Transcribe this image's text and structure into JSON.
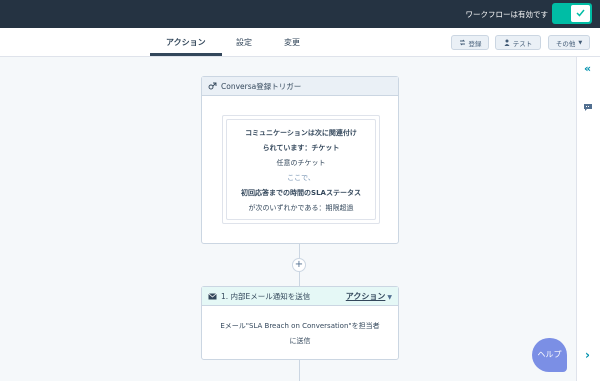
{
  "topbar": {
    "workflow_status": "ワークフローは有効です",
    "toggle_on": true
  },
  "tabs": [
    {
      "label": "アクション",
      "active": true
    },
    {
      "label": "設定",
      "active": false
    },
    {
      "label": "変更",
      "active": false
    }
  ],
  "toolbar": {
    "register_label": "登録",
    "test_label": "テスト",
    "more_label": "その他"
  },
  "trigger": {
    "title": "Conversa登録トリガー",
    "lines": [
      "コミュニケーションは次に関連付け",
      "られています：チケット",
      "任意のチケット",
      "ここで、",
      "初回応答までの時間のSLAステータス",
      "が次のいずれかである：期限超過"
    ]
  },
  "action": {
    "title": "1. 内部Eメール通知を送信",
    "menu_label": "アクション",
    "body_lines": [
      "Eメール\"SLA Breach on Conversation\"を担当者",
      "に送信"
    ]
  },
  "help": {
    "label": "ヘルプ"
  },
  "colors": {
    "accent": "#00bda5",
    "topbar": "#253342",
    "help": "#7b8fe5",
    "link": "#0091ae"
  }
}
